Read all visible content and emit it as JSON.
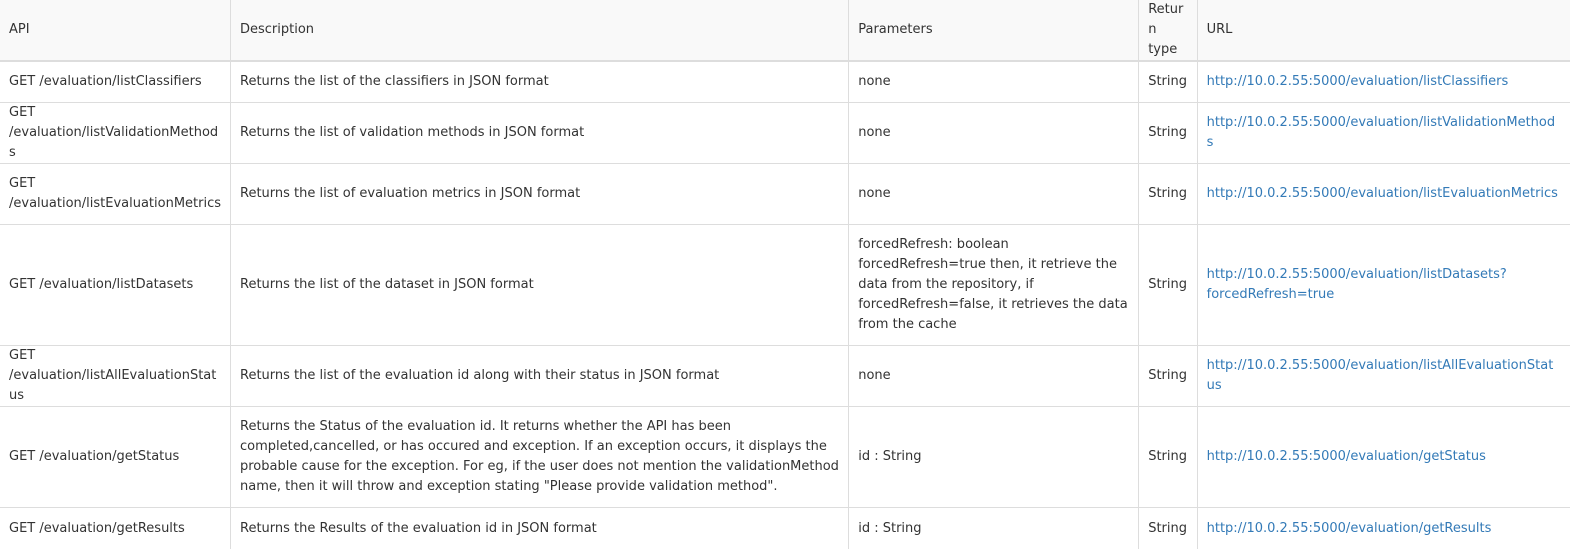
{
  "table": {
    "headers": {
      "api": "API",
      "description": "Description",
      "parameters": "Parameters",
      "return_type": "Return type",
      "url": "URL"
    },
    "rows": [
      {
        "api": "GET /evaluation/listClassifiers",
        "description": "Returns the list of the classifiers in JSON format",
        "parameters": "none",
        "return_type": "String",
        "url": "http://10.0.2.55:5000/evaluation/listClassifiers"
      },
      {
        "api": "GET /evaluation/listValidationMethods",
        "description": "Returns the list of validation methods in JSON format",
        "parameters": "none",
        "return_type": "String",
        "url": "http://10.0.2.55:5000/evaluation/listValidationMethods"
      },
      {
        "api": "GET /evaluation/listEvaluationMetrics",
        "description": "Returns the list of evaluation metrics in JSON format",
        "parameters": "none",
        "return_type": "String",
        "url": "http://10.0.2.55:5000/evaluation/listEvaluationMetrics"
      },
      {
        "api": "GET /evaluation/listDatasets",
        "description": "Returns the list of the dataset in JSON format",
        "parameters": "forcedRefresh: boolean forcedRefresh=true then, it retrieve the data from the repository, if forcedRefresh=false, it retrieves the data from the cache",
        "return_type": "String",
        "url": "http://10.0.2.55:5000/evaluation/listDatasets?forcedRefresh=true"
      },
      {
        "api": "GET /evaluation/listAllEvaluationStatus",
        "description": "Returns the list of the evaluation id along with their status in JSON format",
        "parameters": "none",
        "return_type": "String",
        "url": "http://10.0.2.55:5000/evaluation/listAllEvaluationStatus"
      },
      {
        "api": "GET /evaluation/getStatus",
        "description": "Returns the Status of the evaluation id. It returns whether the API has been completed,cancelled, or has occured and exception. If an exception occurs, it displays the probable cause for the exception. For eg, if the user does not mention the validationMethod name, then it will throw and exception stating \"Please provide validation method\".",
        "parameters": "id : String",
        "return_type": "String",
        "url": "http://10.0.2.55:5000/evaluation/getStatus"
      },
      {
        "api": "GET /evaluation/getResults",
        "description": "Returns the Results of the evaluation id in JSON format",
        "parameters": "id : String",
        "return_type": "String",
        "url": "http://10.0.2.55:5000/evaluation/getResults"
      }
    ]
  }
}
